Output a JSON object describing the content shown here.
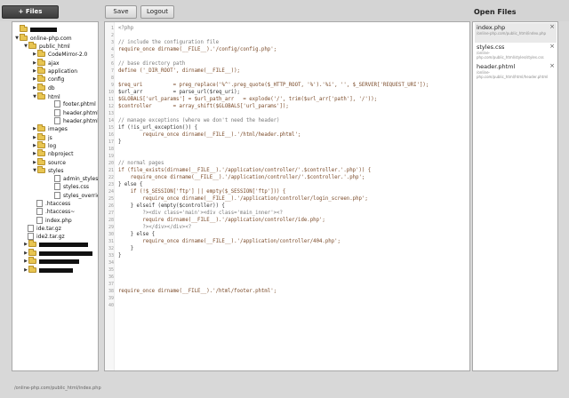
{
  "toolbar": {
    "files_label": "+ Files",
    "save_label": "Save",
    "logout_label": "Logout",
    "open_files_title": "Open Files"
  },
  "tree": [
    {
      "label": "",
      "type": "folder",
      "open": true,
      "redacted": true
    },
    {
      "label": "online-php.com",
      "type": "folder",
      "open": true
    },
    {
      "label": "public_html",
      "type": "folder",
      "open": true
    },
    {
      "label": "CodeMirror-2.0",
      "type": "folder",
      "open": false
    },
    {
      "label": "ajax",
      "type": "folder",
      "open": false
    },
    {
      "label": "application",
      "type": "folder",
      "open": false
    },
    {
      "label": "config",
      "type": "folder",
      "open": false
    },
    {
      "label": "db",
      "type": "folder",
      "open": false
    },
    {
      "label": "html",
      "type": "folder",
      "open": true
    },
    {
      "label": "footer.phtml",
      "type": "file"
    },
    {
      "label": "header.phtml",
      "type": "file"
    },
    {
      "label": "header.phtml~",
      "type": "file"
    },
    {
      "label": "images",
      "type": "folder",
      "open": false
    },
    {
      "label": "js",
      "type": "folder",
      "open": false
    },
    {
      "label": "log",
      "type": "folder",
      "open": false
    },
    {
      "label": "nbproject",
      "type": "folder",
      "open": false
    },
    {
      "label": "source",
      "type": "folder",
      "open": false
    },
    {
      "label": "styles",
      "type": "folder",
      "open": true
    },
    {
      "label": "admin_styles.css",
      "type": "file"
    },
    {
      "label": "styles.css",
      "type": "file"
    },
    {
      "label": "styles_override.css",
      "type": "file"
    },
    {
      "label": ".htaccess",
      "type": "file"
    },
    {
      "label": ".htaccess~",
      "type": "file"
    },
    {
      "label": "index.php",
      "type": "file"
    },
    {
      "label": "ide.tar.gz",
      "type": "file"
    },
    {
      "label": "ide2.tar.gz",
      "type": "file"
    },
    {
      "label": "",
      "type": "folder",
      "open": false,
      "redacted": true
    },
    {
      "label": "",
      "type": "folder",
      "open": false,
      "redacted": true
    },
    {
      "label": "",
      "type": "folder",
      "open": false,
      "redacted": true
    },
    {
      "label": "",
      "type": "folder",
      "open": false,
      "redacted": true
    }
  ],
  "code_lines": [
    "<?php",
    "",
    "// include the configuration file",
    "require_once dirname(__FILE__).'/config/config.php';",
    "",
    "// base directory path",
    "define ('_DIR_ROOT', dirname(__FILE__));",
    "",
    "$req_uri          = preg_replace('%^'.preg_quote($_HTTP_ROOT, '%').'%i', '', $_SERVER['REQUEST_URI']);",
    "$url_arr          = parse_url($req_uri);",
    "$GLOBALS['url_params'] = $url_path_arr   = explode('/', trim($url_arr['path'], '/'));",
    "$controller       = array_shift($GLOBALS['url_params']);",
    "",
    "// manage exceptions (where we don't need the header)",
    "if (!is_url_exception()) {",
    "        require_once dirname(__FILE__).'/html/header.phtml';",
    "}",
    "",
    "",
    "// normal pages",
    "if (file_exists(dirname(__FILE__).'/application/controller/'.$controller.'.php')) {",
    "    require_once dirname(__FILE__).'/application/controller/'.$controller.'.php';",
    "} else {",
    "    if (!$_SESSION['ftp'] || empty($_SESSION['ftp'])) {",
    "        require_once dirname(__FILE__).'/application/controller/login_screen.php';",
    "    } elseif (empty($controller)) {",
    "        ?><div class='main'><div class='main_inner'><?",
    "        require dirname(__FILE__).'/application/controller/ide.php';",
    "        ?></div></div><?",
    "    } else {",
    "        require_once dirname(__FILE__).'/application/controller/404.php';",
    "    }",
    "}",
    "",
    "",
    "",
    "",
    "require_once dirname(__FILE__).'/html/footer.phtml';",
    "",
    ""
  ],
  "open_files": [
    {
      "name": "index.php",
      "path": "/online-php.com/public_html/index.php",
      "active": true
    },
    {
      "name": "styles.css",
      "path": "/online-php.com/public_html/styles/styles.css",
      "active": false
    },
    {
      "name": "header.phtml",
      "path": "/online-php.com/public_html/html/header.phtml",
      "active": false
    }
  ],
  "open_files_close": "×",
  "status": {
    "path": "/online-php.com/public_html/index.php"
  },
  "colors": {
    "folder": "#e8c552",
    "comment": "#7a7a7a",
    "string": "#7a4a28",
    "files_button": "#4a4a4a"
  }
}
